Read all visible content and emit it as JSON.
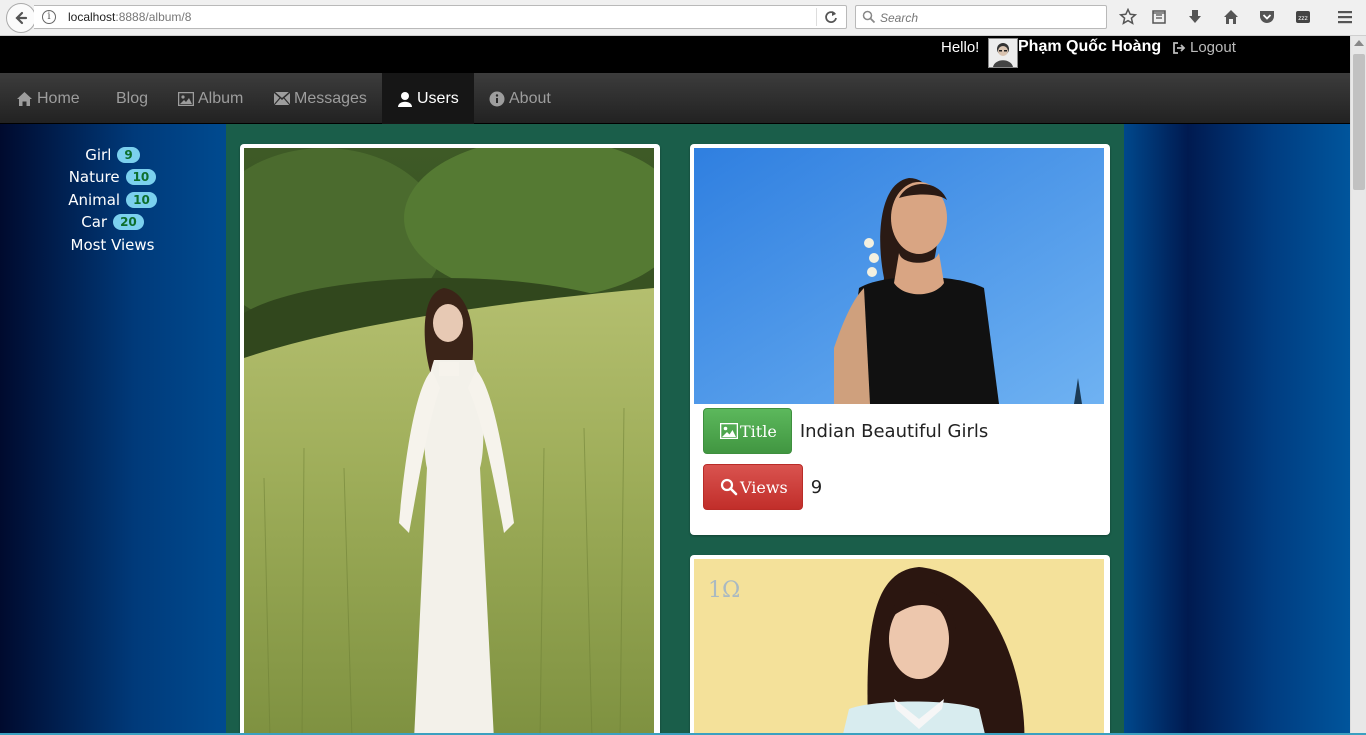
{
  "browser": {
    "url_host": "localhost",
    "url_rest": ":8888/album/8",
    "search_placeholder": "Search"
  },
  "topbar": {
    "greeting": "Hello!",
    "user_name": "Phạm Quốc Hoàng",
    "logout_label": "Logout"
  },
  "nav": {
    "items": [
      {
        "label": "Home",
        "icon": "home-icon"
      },
      {
        "label": "Blog",
        "icon": ""
      },
      {
        "label": "Album",
        "icon": "picture-icon"
      },
      {
        "label": "Messages",
        "icon": "envelope-icon"
      },
      {
        "label": "Users",
        "icon": "user-icon"
      },
      {
        "label": "About",
        "icon": "info-icon"
      }
    ],
    "active": "Users"
  },
  "sidebar": {
    "categories": [
      {
        "label": "Girl",
        "count": "9"
      },
      {
        "label": "Nature",
        "count": "10"
      },
      {
        "label": "Animal",
        "count": "10"
      },
      {
        "label": "Car",
        "count": "20"
      },
      {
        "label": "Most Views",
        "count": ""
      }
    ]
  },
  "album": {
    "photos": [
      {
        "alt": "girl-in-white-dress-photo"
      },
      {
        "alt": "indian-girl-photo",
        "title_button": "Title",
        "title": "Indian Beautiful Girls",
        "views_button": "Views",
        "views": "9"
      },
      {
        "alt": "girl-yellow-background-photo"
      }
    ]
  },
  "colors": {
    "main_bg": "#1a5e4a",
    "badge_bg": "#7bd0ee",
    "badge_text": "#0d6e2c",
    "btn_green": "#5cb85c",
    "btn_red": "#d9534f"
  }
}
